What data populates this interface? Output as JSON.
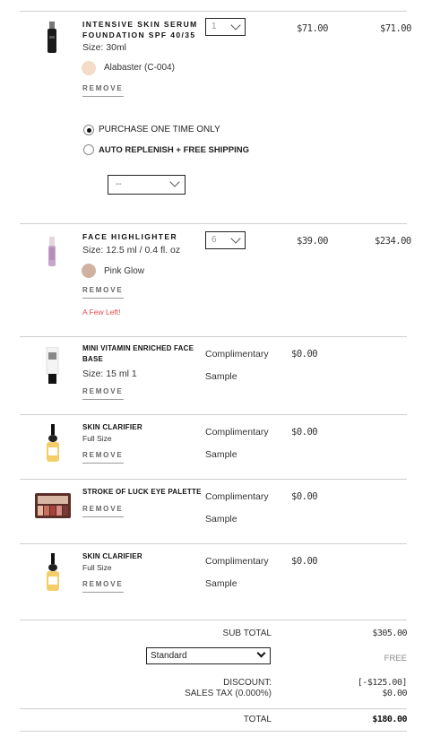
{
  "items": [
    {
      "name_line1": "INTENSIVE SKIN SERUM",
      "name_line2": "FOUNDATION SPF 40/35",
      "size": "Size: 30ml",
      "shade": "Alabaster (C-004)",
      "shade_color": "#f3dcc8",
      "qty": "1",
      "unit_price": "$71.00",
      "total_price": "$71.00",
      "remove": "REMOVE",
      "purchase_options": [
        "PURCHASE ONE TIME ONLY",
        "AUTO REPLENISH + FREE SHIPPING"
      ],
      "replenish_select": "--"
    },
    {
      "name_line1": "FACE HIGHLIGHTER",
      "size": "Size: 12.5 ml / 0.4 fl. oz",
      "shade": "Pink Glow",
      "shade_color": "#d1b19f",
      "qty": "6",
      "unit_price": "$39.00",
      "total_price": "$234.00",
      "remove": "REMOVE",
      "stock_warning": "A Few Left!"
    },
    {
      "name_line1": "MINI VITAMIN ENRICHED FACE",
      "name_line2": "BASE",
      "size": "Size: 15 ml 1",
      "comp1": "Complimentary",
      "comp2": "Sample",
      "price": "$0.00",
      "remove": "REMOVE"
    },
    {
      "name_line1": "SKIN CLARIFIER",
      "size": "Full Size",
      "comp1": "Complimentary",
      "comp2": "Sample",
      "price": "$0.00",
      "remove": "REMOVE"
    },
    {
      "name_line1": "STROKE OF LUCK EYE PALETTE",
      "comp1": "Complimentary",
      "comp2": "Sample",
      "price": "$0.00",
      "remove": "REMOVE"
    },
    {
      "name_line1": "SKIN CLARIFIER",
      "size": "Full Size",
      "comp1": "Complimentary",
      "comp2": "Sample",
      "price": "$0.00",
      "remove": "REMOVE"
    }
  ],
  "totals": {
    "subtotal_label": "SUB TOTAL",
    "subtotal_value": "$305.00",
    "shipping_select": "Standard",
    "shipping_value": "FREE",
    "discount_label": "DISCOUNT:",
    "discount_value": "[-$125.00]",
    "tax_label": "SALES TAX (0.000%)",
    "tax_value": "$0.00",
    "total_label": "TOTAL",
    "total_value": "$180.00"
  }
}
